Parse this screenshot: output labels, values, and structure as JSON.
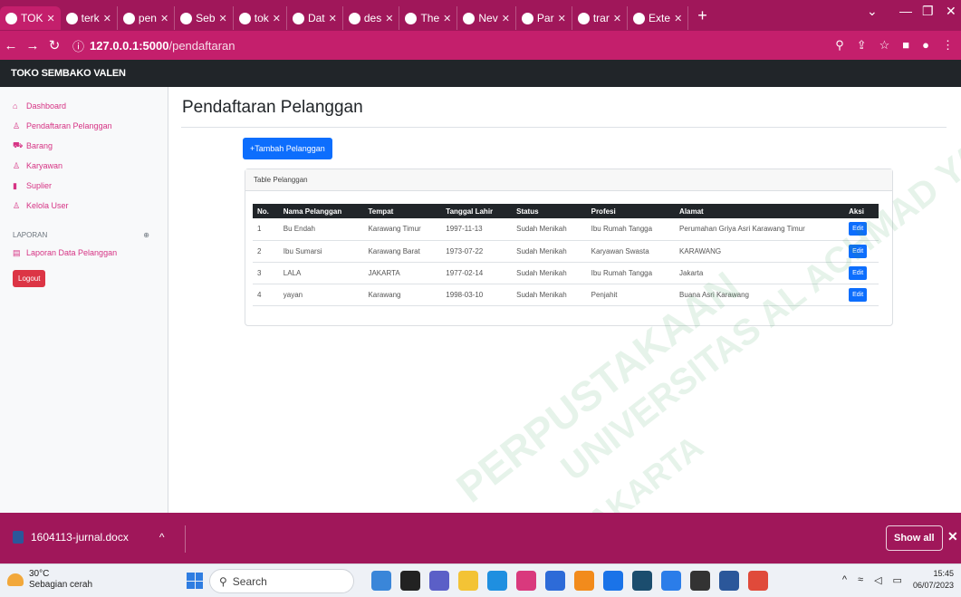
{
  "browser": {
    "tabs": [
      {
        "label": "TOK",
        "active": true
      },
      {
        "label": "terk"
      },
      {
        "label": "pen"
      },
      {
        "label": "Seb"
      },
      {
        "label": "tok"
      },
      {
        "label": "Dat"
      },
      {
        "label": "des"
      },
      {
        "label": "The"
      },
      {
        "label": "Nev"
      },
      {
        "label": "Par"
      },
      {
        "label": "trar"
      },
      {
        "label": "Exte"
      }
    ],
    "url_host": "127.0.0.1:5000",
    "url_path": "/pendaftaran"
  },
  "app": {
    "brand": "TOKO SEMBAKO VALEN"
  },
  "sidebar": {
    "items": [
      {
        "label": "Dashboard",
        "icon": "home-icon"
      },
      {
        "label": "Pendaftaran Pelanggan",
        "icon": "users-icon"
      },
      {
        "label": "Barang",
        "icon": "cart-icon"
      },
      {
        "label": "Karyawan",
        "icon": "users-icon"
      },
      {
        "label": "Suplier",
        "icon": "bar-chart-icon"
      },
      {
        "label": "Kelola User",
        "icon": "user-icon"
      }
    ],
    "section_heading": "LAPORAN",
    "report_item": "Laporan Data Pelanggan",
    "logout_label": "Logout"
  },
  "main": {
    "title": "Pendaftaran Pelanggan",
    "add_button": "+Tambah Pelanggan",
    "card_title": "Table Pelanggan",
    "columns": [
      "No.",
      "Nama Pelanggan",
      "Tempat",
      "Tanggal Lahir",
      "Status",
      "Profesi",
      "Alamat",
      "Aksi"
    ],
    "rows": [
      [
        "1",
        "Bu Endah",
        "Karawang Timur",
        "1997-11-13",
        "Sudah Menikah",
        "Ibu Rumah Tangga",
        "Perumahan Griya Asri Karawang Timur"
      ],
      [
        "2",
        "Ibu Sumarsi",
        "Karawang Barat",
        "1973-07-22",
        "Sudah Menikah",
        "Karyawan Swasta",
        "KARAWANG"
      ],
      [
        "3",
        "LALA",
        "JAKARTA",
        "1977-02-14",
        "Sudah Menikah",
        "Ibu Rumah Tangga",
        "Jakarta"
      ],
      [
        "4",
        "yayan",
        "Karawang",
        "1998-03-10",
        "Sudah Menikah",
        "Penjahit",
        "Buana Asri Karawang"
      ]
    ],
    "edit_label": "Edit"
  },
  "downloads": {
    "file": "1604113-jurnal.docx",
    "show_all": "Show all"
  },
  "taskbar": {
    "temp": "30°C",
    "weather": "Sebagian cerah",
    "search": "Search",
    "time": "15:45",
    "date": "06/07/2023"
  },
  "watermark": [
    "PERPUSTAKAAN",
    "UNIVERSITAS AL ACHMAD YANI",
    "JAKARTA"
  ],
  "colors": {
    "browser_frame": "#a0175a",
    "primary": "#0d6efd",
    "danger": "#dc3545",
    "navbar": "#212529",
    "sidebar_link": "#d63384"
  }
}
